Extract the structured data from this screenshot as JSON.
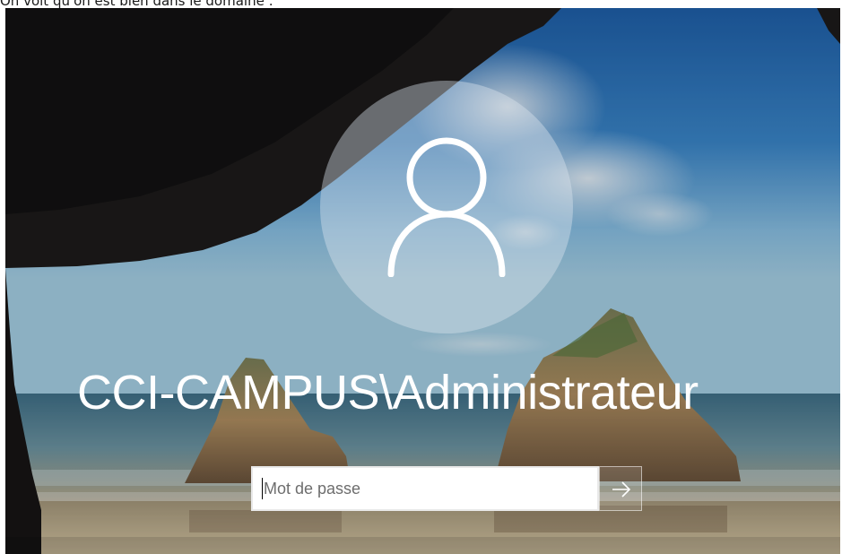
{
  "caption": {
    "text": "On voit qu'on est bien dans le domaine :"
  },
  "login": {
    "user_name": "CCI-CAMPUS\\Administrateur",
    "password_placeholder": "Mot de passe",
    "password_value": "",
    "avatar_icon": "user-silhouette-icon",
    "submit_icon": "arrow-right-icon"
  },
  "colors": {
    "text_on_background": "#ffffff",
    "input_background": "#ffffff",
    "input_border": "#e9e9e9",
    "avatar_circle": "rgba(220,228,238,0.42)"
  }
}
